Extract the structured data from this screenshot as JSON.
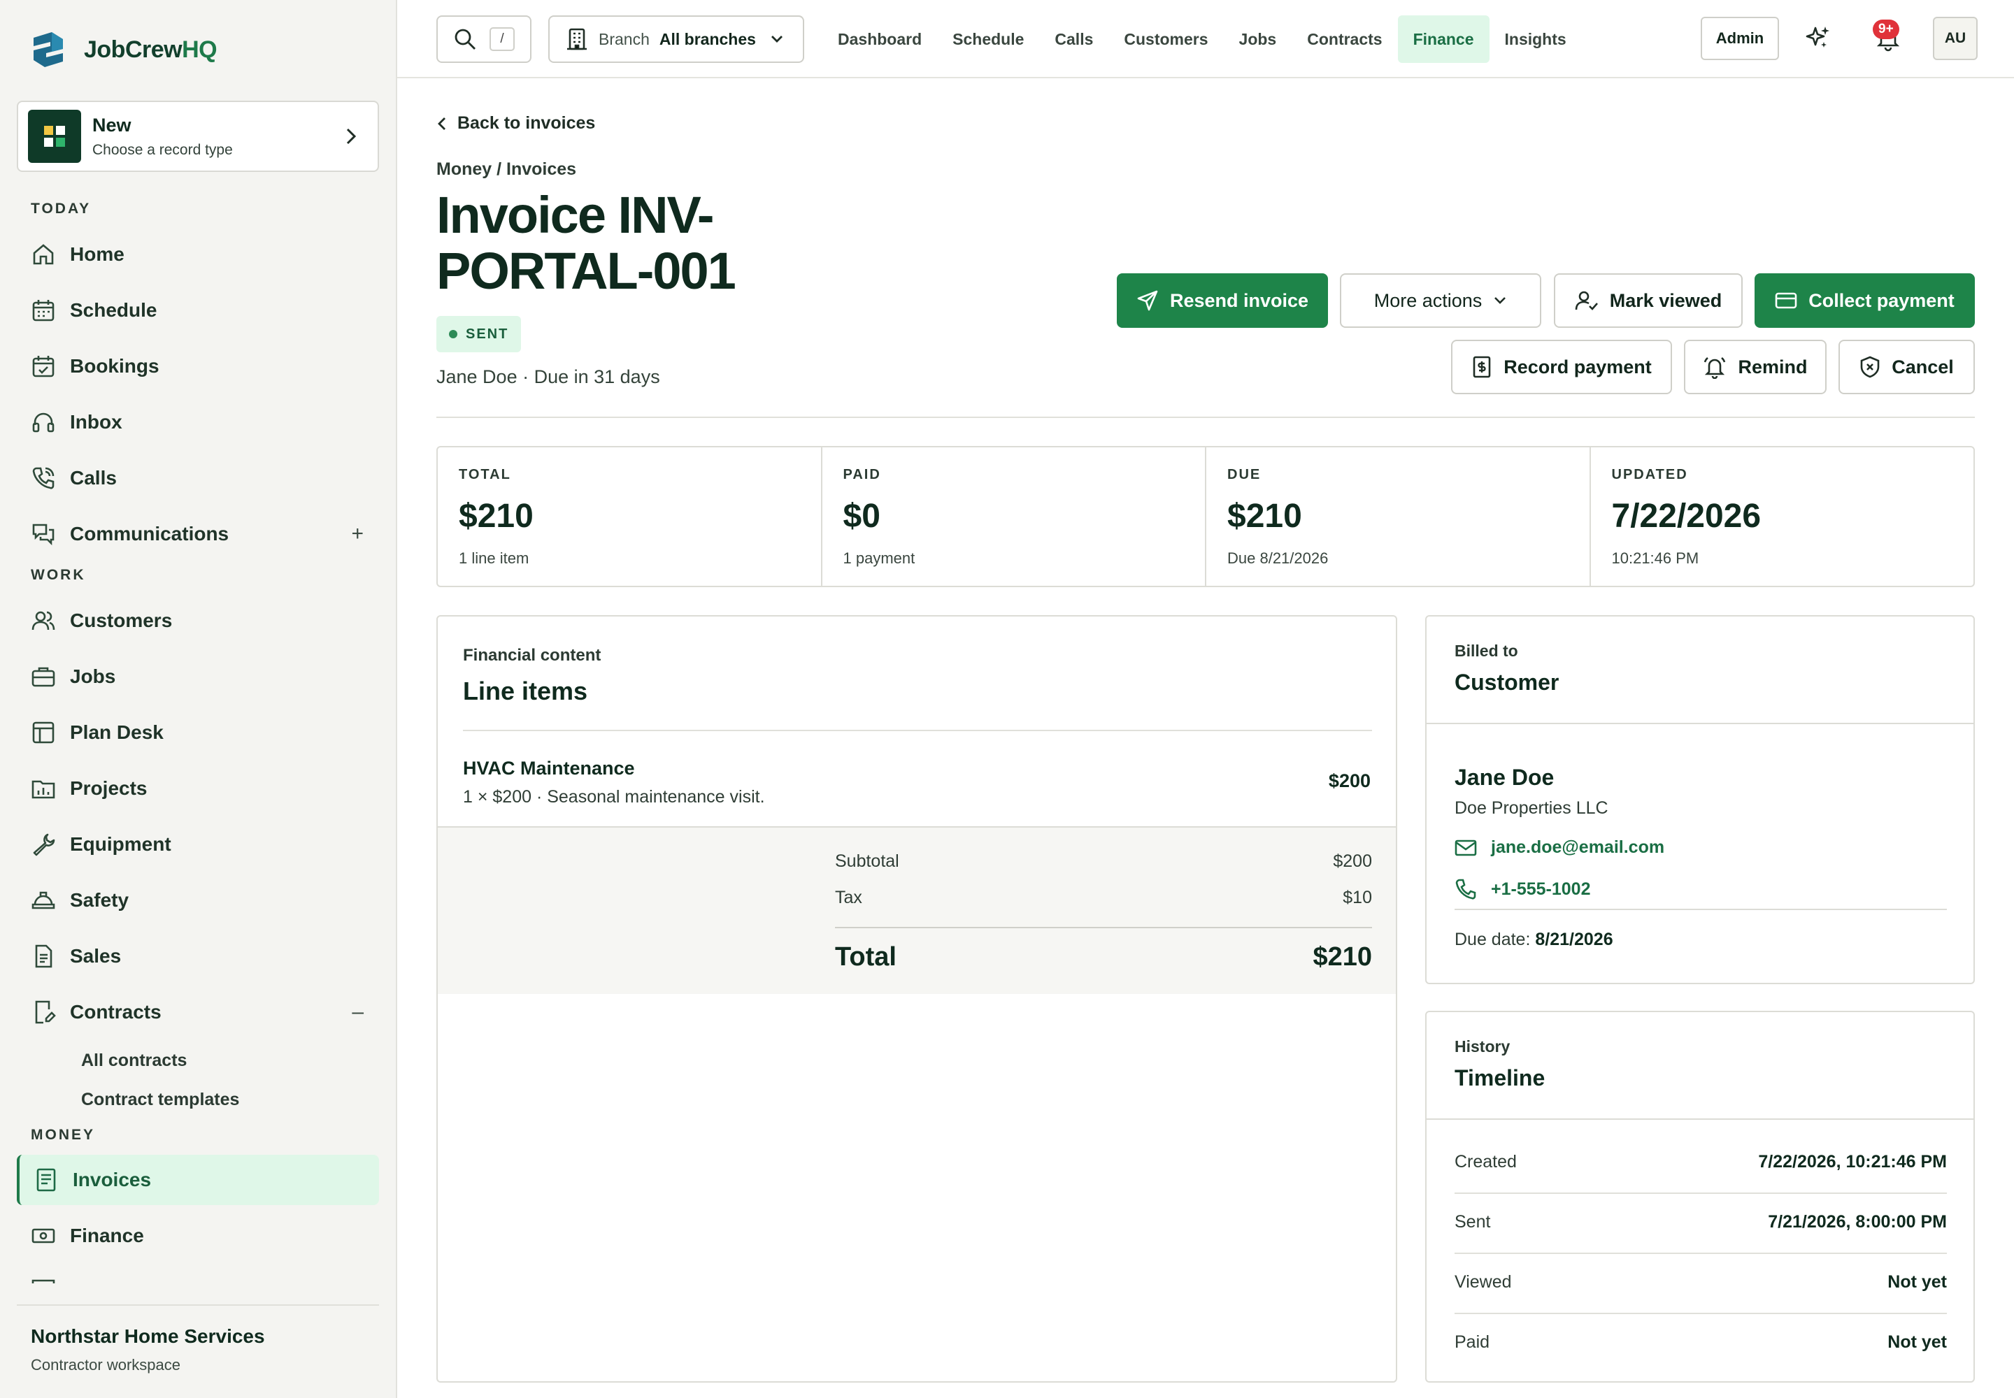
{
  "brand": {
    "name_part1": "JobCrew",
    "name_part2": "HQ"
  },
  "new_card": {
    "title": "New",
    "subtitle": "Choose a record type"
  },
  "sidebar": {
    "sections": {
      "today": "TODAY",
      "work": "WORK",
      "money": "MONEY"
    },
    "items": {
      "home": "Home",
      "schedule": "Schedule",
      "bookings": "Bookings",
      "inbox": "Inbox",
      "calls": "Calls",
      "communications": "Communications",
      "customers": "Customers",
      "jobs": "Jobs",
      "plan_desk": "Plan Desk",
      "projects": "Projects",
      "equipment": "Equipment",
      "safety": "Safety",
      "sales": "Sales",
      "contracts": "Contracts",
      "invoices": "Invoices",
      "finance": "Finance"
    },
    "communications_toggle": "+",
    "contracts_toggle": "–",
    "contracts_sub": [
      "All contracts",
      "Contract templates"
    ],
    "org": {
      "name": "Northstar Home Services",
      "subtitle": "Contractor workspace"
    }
  },
  "topbar": {
    "search_shortcut": "/",
    "branch_label": "Branch",
    "branch_value": "All branches",
    "nav": [
      "Dashboard",
      "Schedule",
      "Calls",
      "Customers",
      "Jobs",
      "Contracts",
      "Finance",
      "Insights"
    ],
    "active_nav": "Finance",
    "admin_label": "Admin",
    "notifications_badge": "9+",
    "avatar_initials": "AU"
  },
  "page": {
    "back_label": "Back to invoices",
    "breadcrumb": "Money / Invoices",
    "title": "Invoice INV-PORTAL-001",
    "status": "SENT",
    "meta": "Jane Doe · Due in 31 days"
  },
  "actions": {
    "resend": "Resend invoice",
    "more": "More actions",
    "mark_viewed": "Mark viewed",
    "collect": "Collect payment",
    "record": "Record payment",
    "remind": "Remind",
    "cancel": "Cancel"
  },
  "stats": [
    {
      "key": "TOTAL",
      "value": "$210",
      "sub": "1 line item"
    },
    {
      "key": "PAID",
      "value": "$0",
      "sub": "1 payment"
    },
    {
      "key": "DUE",
      "value": "$210",
      "sub": "Due 8/21/2026"
    },
    {
      "key": "UPDATED",
      "value": "7/22/2026",
      "sub": "10:21:46 PM"
    }
  ],
  "line_items": {
    "eyebrow": "Financial content",
    "title": "Line items",
    "items": [
      {
        "name": "HVAC Maintenance",
        "desc": "1 × $200 · Seasonal maintenance visit.",
        "amount": "$200"
      }
    ],
    "subtotal_label": "Subtotal",
    "subtotal": "$200",
    "tax_label": "Tax",
    "tax": "$10",
    "total_label": "Total",
    "total": "$210"
  },
  "billed": {
    "eyebrow": "Billed to",
    "title": "Customer",
    "name": "Jane Doe",
    "company": "Doe Properties LLC",
    "email": "jane.doe@email.com",
    "phone": "+1-555-1002",
    "due_label": "Due date:",
    "due_value": "8/21/2026"
  },
  "history": {
    "eyebrow": "History",
    "title": "Timeline",
    "rows": [
      {
        "k": "Created",
        "v": "7/22/2026, 10:21:46 PM"
      },
      {
        "k": "Sent",
        "v": "7/21/2026, 8:00:00 PM"
      },
      {
        "k": "Viewed",
        "v": "Not yet"
      },
      {
        "k": "Paid",
        "v": "Not yet"
      }
    ]
  },
  "colors": {
    "accent": "#1e8449",
    "accent_soft": "#dff7e8",
    "brand_dark": "#0f3a28"
  }
}
